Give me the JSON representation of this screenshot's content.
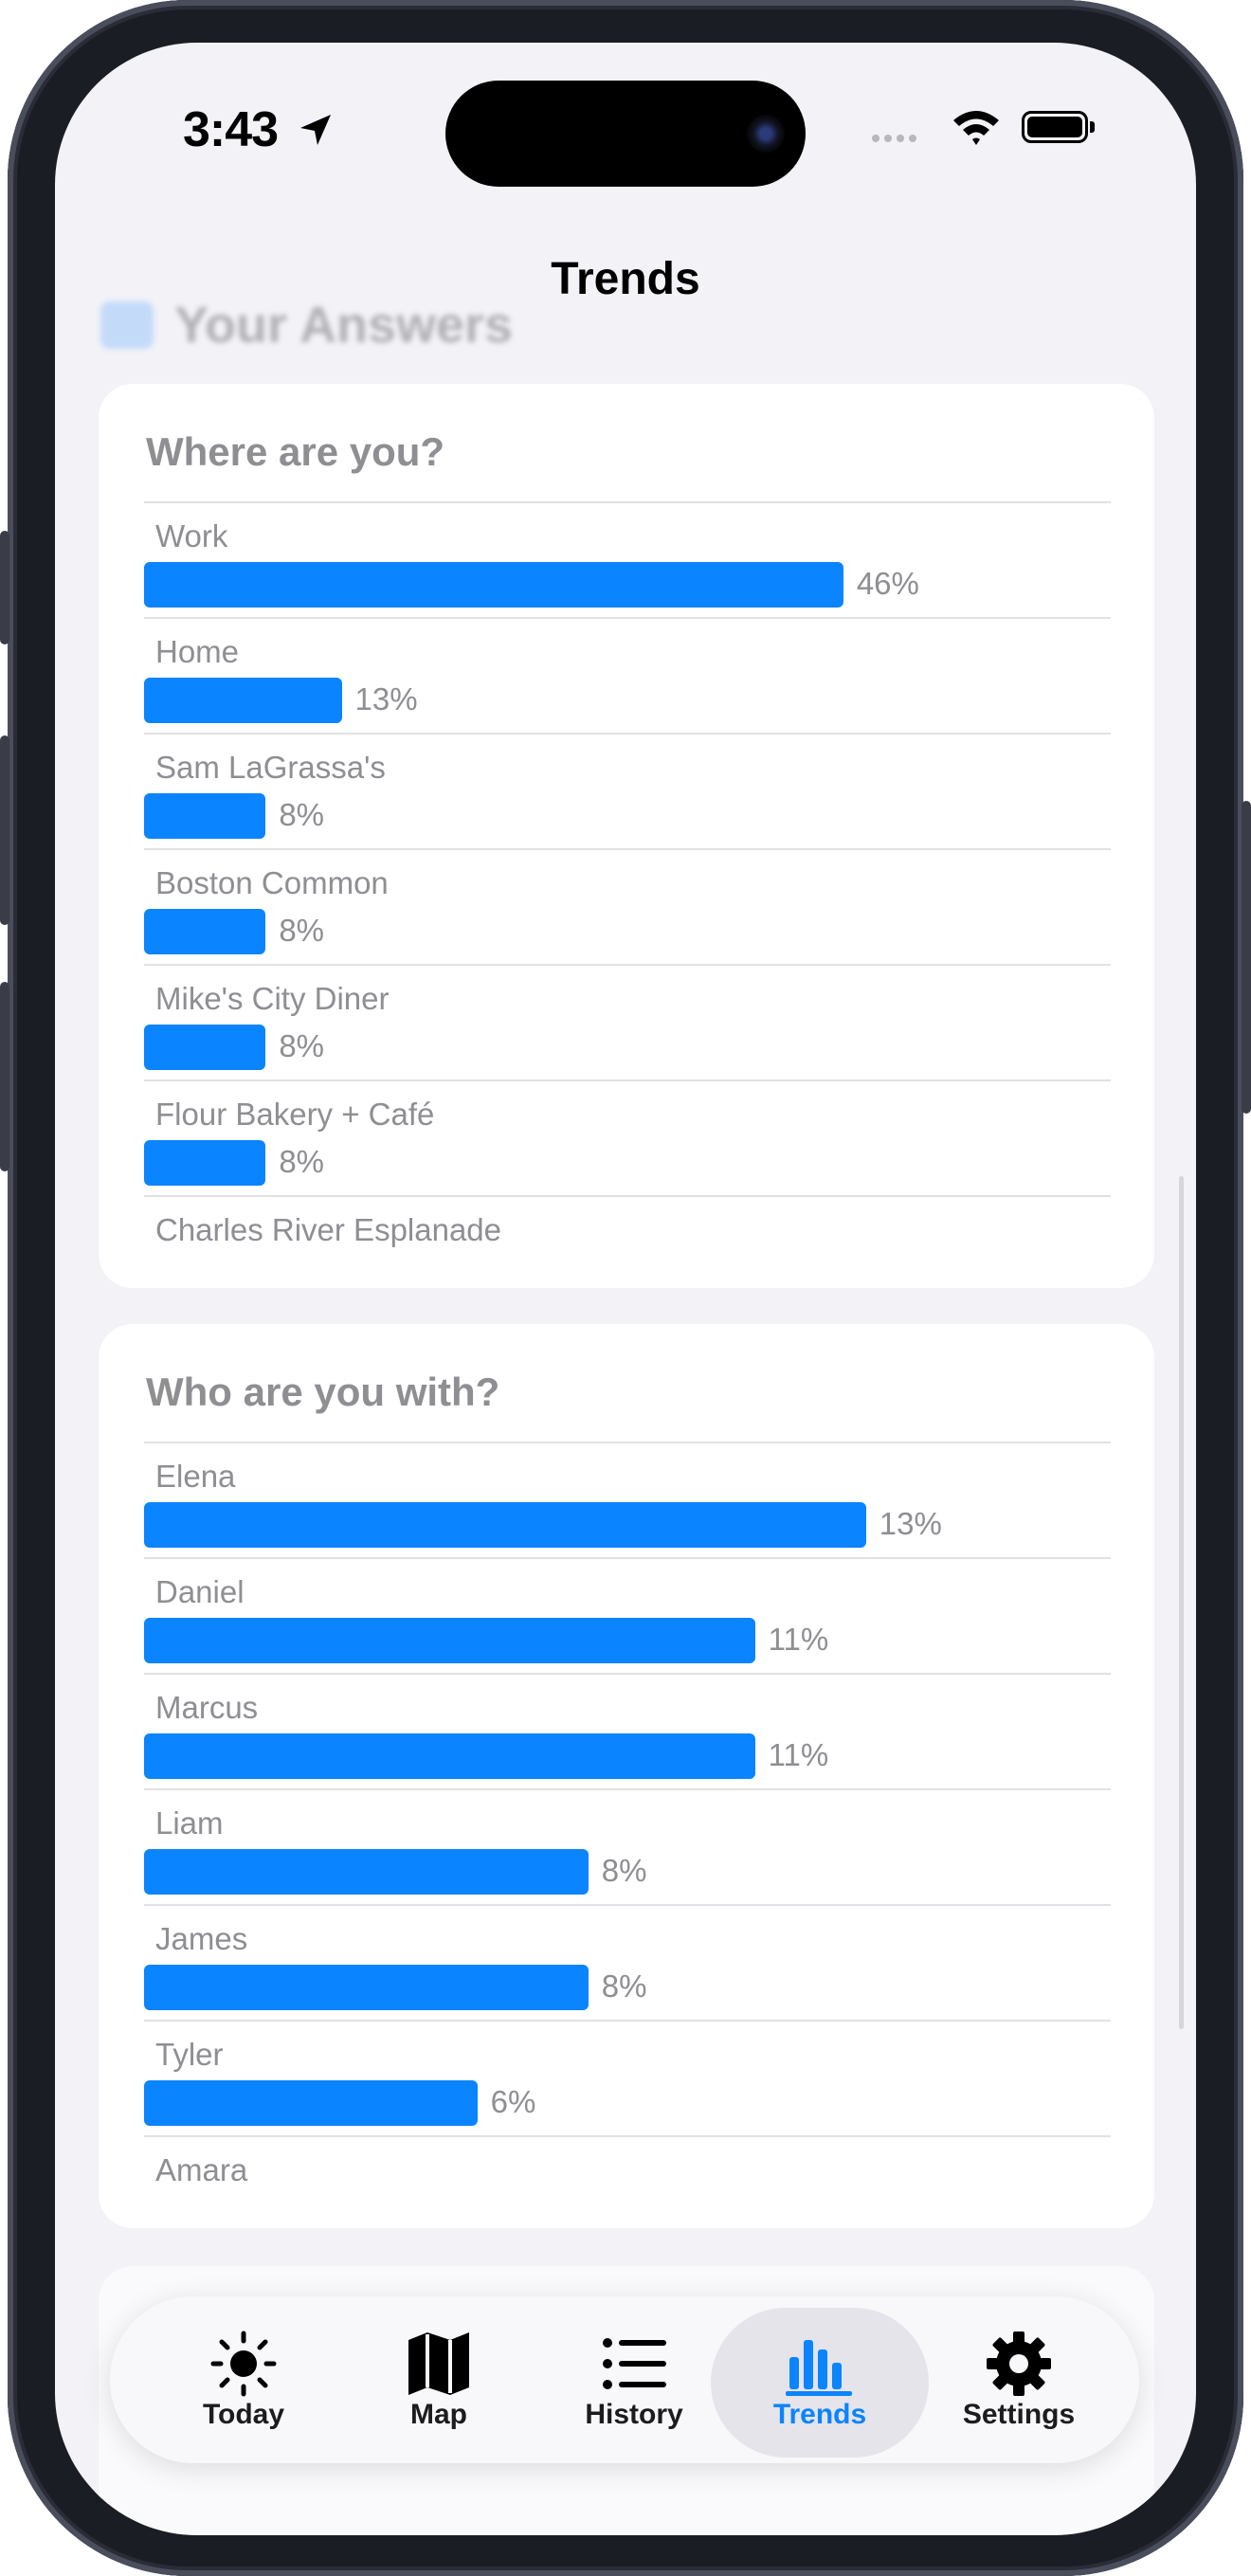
{
  "status_bar": {
    "time": "3:43"
  },
  "nav": {
    "title": "Trends"
  },
  "section_header": "Your Answers",
  "where": {
    "title": "Where are you?",
    "rows": [
      {
        "label": "Work",
        "pct": "46%",
        "fraction": 0.46
      },
      {
        "label": "Home",
        "pct": "13%",
        "fraction": 0.13
      },
      {
        "label": "Sam LaGrassa's",
        "pct": "8%",
        "fraction": 0.08
      },
      {
        "label": "Boston Common",
        "pct": "8%",
        "fraction": 0.08
      },
      {
        "label": "Mike's City Diner",
        "pct": "8%",
        "fraction": 0.08
      },
      {
        "label": "Flour Bakery + Café",
        "pct": "8%",
        "fraction": 0.08
      },
      {
        "label": "Charles River Esplanade"
      }
    ]
  },
  "who": {
    "title": "Who are you with?",
    "rows": [
      {
        "label": "Elena",
        "pct": "13%",
        "fraction": 0.13
      },
      {
        "label": "Daniel",
        "pct": "11%",
        "fraction": 0.11
      },
      {
        "label": "Marcus",
        "pct": "11%",
        "fraction": 0.11
      },
      {
        "label": "Liam",
        "pct": "8%",
        "fraction": 0.08
      },
      {
        "label": "James",
        "pct": "8%",
        "fraction": 0.08
      },
      {
        "label": "Tyler",
        "pct": "6%",
        "fraction": 0.06
      },
      {
        "label": "Amara"
      }
    ]
  },
  "tabs": [
    {
      "label": "Today",
      "icon": "sun-icon"
    },
    {
      "label": "Map",
      "icon": "map-icon"
    },
    {
      "label": "History",
      "icon": "list-icon"
    },
    {
      "label": "Trends",
      "icon": "chart-icon",
      "active": true
    },
    {
      "label": "Settings",
      "icon": "gear-icon"
    }
  ],
  "colors": {
    "accent": "#0a84ff",
    "background": "#f2f2f7",
    "secondary_text": "#8e8e93"
  }
}
